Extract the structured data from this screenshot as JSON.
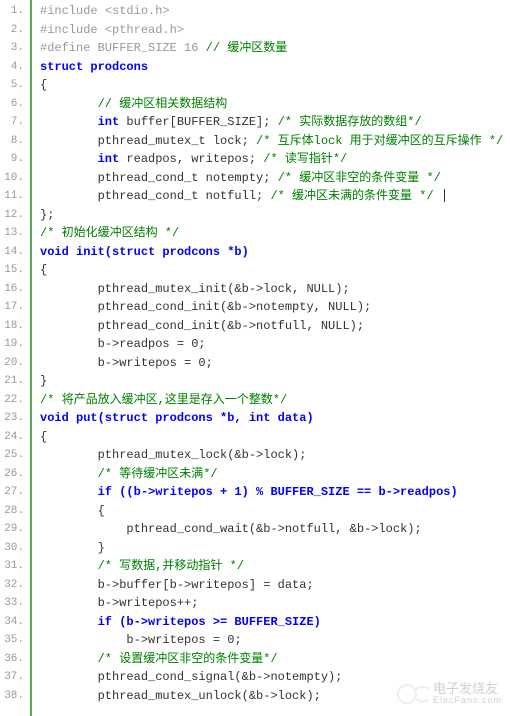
{
  "lines": [
    {
      "n": "1.",
      "indent": 0,
      "tokens": [
        {
          "c": "preproc",
          "t": "#include <stdio.h>"
        }
      ]
    },
    {
      "n": "2.",
      "indent": 0,
      "tokens": [
        {
          "c": "preproc",
          "t": "#include <pthread.h>"
        }
      ]
    },
    {
      "n": "3.",
      "indent": 0,
      "tokens": [
        {
          "c": "preproc",
          "t": "#define BUFFER_SIZE 16 "
        },
        {
          "c": "comment",
          "t": "// 缓冲区数量"
        }
      ]
    },
    {
      "n": "4.",
      "indent": 0,
      "tokens": [
        {
          "c": "keyword",
          "t": "struct prodcons"
        }
      ]
    },
    {
      "n": "5.",
      "indent": 0,
      "tokens": [
        {
          "c": "plain",
          "t": "{"
        }
      ]
    },
    {
      "n": "6.",
      "indent": 2,
      "tokens": [
        {
          "c": "comment",
          "t": "// 缓冲区相关数据结构"
        }
      ]
    },
    {
      "n": "7.",
      "indent": 2,
      "tokens": [
        {
          "c": "keyword",
          "t": "int"
        },
        {
          "c": "plain",
          "t": " buffer[BUFFER_SIZE]; "
        },
        {
          "c": "comment",
          "t": "/* 实际数据存放的数组*/"
        }
      ]
    },
    {
      "n": "8.",
      "indent": 2,
      "tokens": [
        {
          "c": "plain",
          "t": "pthread_mutex_t lock; "
        },
        {
          "c": "comment",
          "t": "/* 互斥体lock 用于对缓冲区的互斥操作 */"
        }
      ]
    },
    {
      "n": "9.",
      "indent": 2,
      "tokens": [
        {
          "c": "keyword",
          "t": "int"
        },
        {
          "c": "plain",
          "t": " readpos, writepos; "
        },
        {
          "c": "comment",
          "t": "/* 读写指针*/"
        }
      ]
    },
    {
      "n": "10.",
      "indent": 2,
      "tokens": [
        {
          "c": "plain",
          "t": "pthread_cond_t notempty; "
        },
        {
          "c": "comment",
          "t": "/* 缓冲区非空的条件变量 */"
        }
      ]
    },
    {
      "n": "11.",
      "indent": 2,
      "tokens": [
        {
          "c": "plain",
          "t": "pthread_cond_t notfull; "
        },
        {
          "c": "comment",
          "t": "/* 缓冲区未满的条件变量 */"
        }
      ],
      "cursor": true
    },
    {
      "n": "12.",
      "indent": 0,
      "tokens": [
        {
          "c": "plain",
          "t": "};"
        }
      ]
    },
    {
      "n": "13.",
      "indent": 0,
      "tokens": [
        {
          "c": "comment",
          "t": "/* 初始化缓冲区结构 */"
        }
      ]
    },
    {
      "n": "14.",
      "indent": 0,
      "tokens": [
        {
          "c": "keyword",
          "t": "void init(struct prodcons *b)"
        }
      ]
    },
    {
      "n": "15.",
      "indent": 0,
      "tokens": [
        {
          "c": "plain",
          "t": "{"
        }
      ]
    },
    {
      "n": "16.",
      "indent": 2,
      "tokens": [
        {
          "c": "plain",
          "t": "pthread_mutex_init(&b->lock, NULL);"
        }
      ]
    },
    {
      "n": "17.",
      "indent": 2,
      "tokens": [
        {
          "c": "plain",
          "t": "pthread_cond_init(&b->notempty, NULL);"
        }
      ]
    },
    {
      "n": "18.",
      "indent": 2,
      "tokens": [
        {
          "c": "plain",
          "t": "pthread_cond_init(&b->notfull, NULL);"
        }
      ]
    },
    {
      "n": "19.",
      "indent": 2,
      "tokens": [
        {
          "c": "plain",
          "t": "b->readpos = 0;"
        }
      ]
    },
    {
      "n": "20.",
      "indent": 2,
      "tokens": [
        {
          "c": "plain",
          "t": "b->writepos = 0;"
        }
      ]
    },
    {
      "n": "21.",
      "indent": 0,
      "tokens": [
        {
          "c": "plain",
          "t": "}"
        }
      ]
    },
    {
      "n": "22.",
      "indent": 0,
      "tokens": [
        {
          "c": "comment",
          "t": "/* 将产品放入缓冲区,这里是存入一个整数*/"
        }
      ]
    },
    {
      "n": "23.",
      "indent": 0,
      "tokens": [
        {
          "c": "keyword",
          "t": "void put(struct prodcons *b, int data)"
        }
      ]
    },
    {
      "n": "24.",
      "indent": 0,
      "tokens": [
        {
          "c": "plain",
          "t": "{"
        }
      ]
    },
    {
      "n": "25.",
      "indent": 2,
      "tokens": [
        {
          "c": "plain",
          "t": "pthread_mutex_lock(&b->lock);"
        }
      ]
    },
    {
      "n": "26.",
      "indent": 2,
      "tokens": [
        {
          "c": "comment",
          "t": "/* 等待缓冲区未满*/"
        }
      ]
    },
    {
      "n": "27.",
      "indent": 2,
      "tokens": [
        {
          "c": "keyword",
          "t": "if ((b->writepos + 1) % BUFFER_SIZE == b->readpos)"
        }
      ]
    },
    {
      "n": "28.",
      "indent": 2,
      "tokens": [
        {
          "c": "plain",
          "t": "{"
        }
      ]
    },
    {
      "n": "29.",
      "indent": 3,
      "tokens": [
        {
          "c": "plain",
          "t": "pthread_cond_wait(&b->notfull, &b->lock);"
        }
      ]
    },
    {
      "n": "30.",
      "indent": 2,
      "tokens": [
        {
          "c": "plain",
          "t": "}"
        }
      ]
    },
    {
      "n": "31.",
      "indent": 2,
      "tokens": [
        {
          "c": "comment",
          "t": "/* 写数据,并移动指针 */"
        }
      ]
    },
    {
      "n": "32.",
      "indent": 2,
      "tokens": [
        {
          "c": "plain",
          "t": "b->buffer[b->writepos] = data;"
        }
      ]
    },
    {
      "n": "33.",
      "indent": 2,
      "tokens": [
        {
          "c": "plain",
          "t": "b->writepos++;"
        }
      ]
    },
    {
      "n": "34.",
      "indent": 2,
      "tokens": [
        {
          "c": "keyword",
          "t": "if (b->writepos >= BUFFER_SIZE)"
        }
      ]
    },
    {
      "n": "35.",
      "indent": 3,
      "tokens": [
        {
          "c": "plain",
          "t": "b->writepos = 0;"
        }
      ]
    },
    {
      "n": "36.",
      "indent": 2,
      "tokens": [
        {
          "c": "comment",
          "t": "/* 设置缓冲区非空的条件变量*/"
        }
      ]
    },
    {
      "n": "37.",
      "indent": 2,
      "tokens": [
        {
          "c": "plain",
          "t": "pthread_cond_signal(&b->notempty);"
        }
      ]
    },
    {
      "n": "38.",
      "indent": 2,
      "tokens": [
        {
          "c": "plain",
          "t": "pthread_mutex_unlock(&b->lock);"
        }
      ]
    }
  ],
  "watermark": {
    "title": "电子发烧友",
    "sub": "ElecFans.com"
  }
}
